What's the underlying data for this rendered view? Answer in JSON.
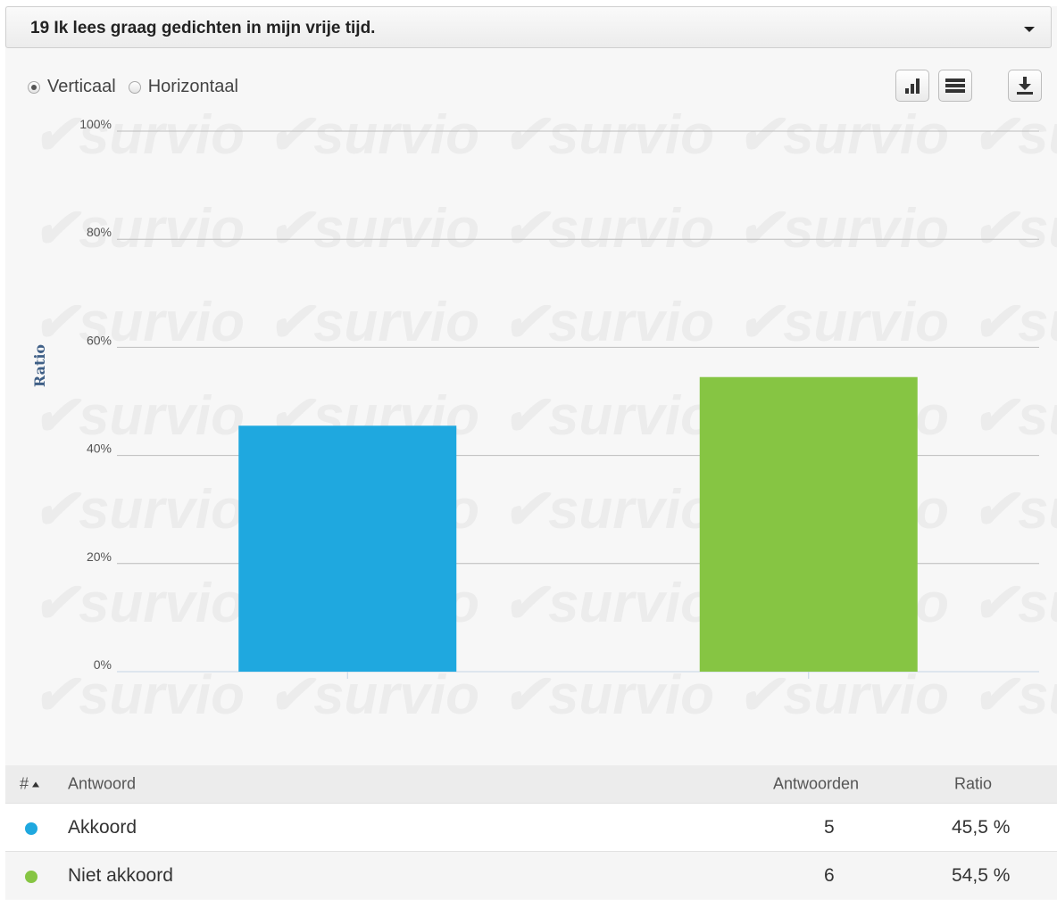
{
  "question": {
    "title": "19 Ik lees graag gedichten in mijn vrije tijd."
  },
  "orientation": {
    "vertical_label": "Verticaal",
    "horizontal_label": "Horizontaal",
    "selected": "vertical"
  },
  "toolbar": {
    "icons": [
      "bar-chart-icon",
      "table-rows-icon",
      "download-icon"
    ]
  },
  "watermark": "survio",
  "chart_data": {
    "type": "bar",
    "categories": [
      "Akkoord",
      "Niet akkoord"
    ],
    "values": [
      45.5,
      54.5
    ],
    "colors": [
      "#1fa8df",
      "#86c543"
    ],
    "ylabel": "Ratio",
    "ylim": [
      0,
      100
    ],
    "yticks": [
      "0%",
      "20%",
      "40%",
      "60%",
      "80%",
      "100%"
    ],
    "ytick_values": [
      0,
      20,
      40,
      60,
      80,
      100
    ],
    "grid": true
  },
  "table": {
    "headers": {
      "index": "#",
      "answer": "Antwoord",
      "count": "Antwoorden",
      "ratio": "Ratio"
    },
    "rows": [
      {
        "answer": "Akkoord",
        "count": "5",
        "ratio": "45,5 %",
        "color": "#1fa8df"
      },
      {
        "answer": "Niet akkoord",
        "count": "6",
        "ratio": "54,5 %",
        "color": "#86c543"
      }
    ]
  }
}
